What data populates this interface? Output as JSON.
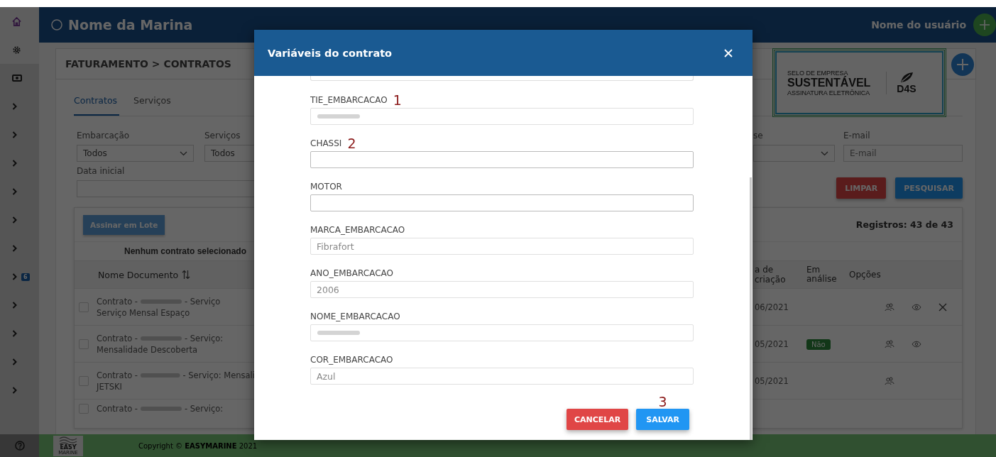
{
  "header": {
    "title": "Nome da Marina",
    "user": "Nome do usuário"
  },
  "sidebar": {
    "items": [
      {
        "kind": "home"
      },
      {
        "kind": "gear"
      },
      {
        "kind": "money"
      },
      {
        "kind": "chevron"
      },
      {
        "kind": "chevron"
      },
      {
        "kind": "chevron"
      },
      {
        "kind": "chevron"
      },
      {
        "kind": "chevron"
      },
      {
        "kind": "chevron"
      },
      {
        "kind": "chevron",
        "badge": "6"
      },
      {
        "kind": "chevron"
      },
      {
        "kind": "chevron"
      },
      {
        "kind": "chevron"
      },
      {
        "kind": "chevron"
      }
    ]
  },
  "breadcrumb": "FATURAMENTO > CONTRATOS",
  "tabs": [
    {
      "label": "Contratos",
      "selected": true
    },
    {
      "label": "Serviços",
      "selected": false
    }
  ],
  "filters": {
    "left": [
      {
        "label": "Embarcação",
        "value": "Todos"
      },
      {
        "label": "Serviços",
        "value": "Todos"
      }
    ],
    "right": [
      {
        "kind": "select",
        "label": "se"
      },
      {
        "kind": "input",
        "label": "E-mail",
        "placeholder": "E-mail"
      }
    ],
    "date": {
      "label": "Data inicial"
    }
  },
  "actions": [
    {
      "label": "LIMPAR",
      "kind": "danger"
    },
    {
      "label": "PESQUISAR",
      "kind": "primary"
    }
  ],
  "seal": {
    "line1": "SELO DE EMPRESA",
    "line2": "SUSTENTÁVEL",
    "line3": "ASSINATURA ELETRÔNICA",
    "brand": "D4S"
  },
  "table": {
    "batch_button": "Assinar em Lote",
    "records": "Registros: 43 de 43",
    "selection_note": "Nenhum contrato selecionado",
    "columns": {
      "name": "Nome Documento",
      "date": "a de criação",
      "review": "Em análise",
      "options": "Opções"
    },
    "rows": [
      {
        "checked": false,
        "prefix": "Contrato -",
        "suffix": "- Serviço",
        "line2": "Serviço Mensal Espaço",
        "date": "06/2021",
        "options": [
          {
            "kind": "signers"
          },
          {
            "kind": "view"
          },
          {
            "kind": "delete"
          }
        ]
      },
      {
        "checked": false,
        "prefix": "Contrato -",
        "suffix": "- Serviço:",
        "line2": "Mensalidade Descoberta",
        "date": "05/2021",
        "badge": "Não",
        "options": [
          {
            "kind": "signers"
          },
          {
            "kind": "view"
          }
        ]
      },
      {
        "checked": false,
        "prefix": "Contrato -",
        "suffix": "- Serviço: Mensali",
        "line2": "JETSKI",
        "date": "05/2021",
        "options": [
          {
            "kind": "signers"
          }
        ]
      },
      {
        "checked": false,
        "prefix": "Contrato -",
        "suffix": "- Serviço:"
      }
    ]
  },
  "modal": {
    "title": "Variáveis do contrato",
    "fields": [
      {
        "label": "TIE_EMBARCACAO",
        "annotation": "1",
        "blurred": true,
        "disabled": true
      },
      {
        "label": "CHASSI",
        "annotation": "2",
        "disabled": false
      },
      {
        "label": "MOTOR",
        "disabled": false
      },
      {
        "label": "MARCA_EMBARCACAO",
        "value": "Fibrafort",
        "disabled": true
      },
      {
        "label": "ANO_EMBARCACAO",
        "value": "2006",
        "disabled": true
      },
      {
        "label": "NOME_EMBARCACAO",
        "blurred": true,
        "disabled": true
      },
      {
        "label": "COR_EMBARCACAO",
        "value": "Azul",
        "disabled": true
      }
    ],
    "buttons": [
      {
        "label": "CANCELAR",
        "kind": "cancel"
      },
      {
        "label": "SALVAR",
        "kind": "save",
        "annotation": "3"
      }
    ]
  },
  "footer": {
    "logo": [
      "EASY",
      "MARINE"
    ],
    "copyright": "Copyright © **EASYMARINE** 2021"
  }
}
